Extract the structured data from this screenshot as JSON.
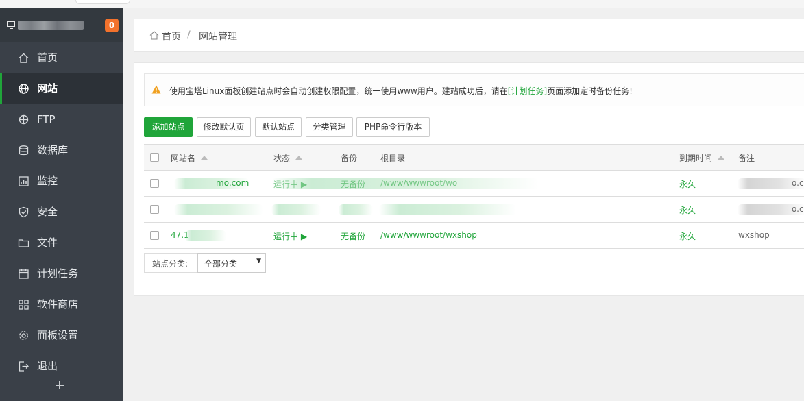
{
  "sidebar": {
    "badge": "0",
    "items": [
      {
        "label": "首页",
        "icon": "home-icon"
      },
      {
        "label": "网站",
        "icon": "globe-icon"
      },
      {
        "label": "FTP",
        "icon": "ftp-icon"
      },
      {
        "label": "数据库",
        "icon": "database-icon"
      },
      {
        "label": "监控",
        "icon": "monitor-icon"
      },
      {
        "label": "安全",
        "icon": "shield-icon"
      },
      {
        "label": "文件",
        "icon": "folder-icon"
      },
      {
        "label": "计划任务",
        "icon": "calendar-icon"
      },
      {
        "label": "软件商店",
        "icon": "apps-grid-icon"
      },
      {
        "label": "面板设置",
        "icon": "gear-icon"
      },
      {
        "label": "退出",
        "icon": "logout-icon"
      }
    ],
    "add_icon": "plus-icon"
  },
  "breadcrumb": {
    "home": "首页",
    "separator": "/",
    "current": "网站管理"
  },
  "alert": {
    "text_before": "使用宝塔Linux面板创建站点时会自动创建权限配置，统一使用www用户。建站成功后，请在",
    "link": "[计划任务]",
    "text_after": "页面添加定时备份任务!"
  },
  "toolbar": {
    "add_site": "添加站点",
    "edit_default_page": "修改默认页",
    "default_site": "默认站点",
    "category_manage": "分类管理",
    "php_cli_version": "PHP命令行版本"
  },
  "table": {
    "headers": {
      "name": "网站名",
      "status": "状态",
      "backup": "备份",
      "root": "根目录",
      "expire": "到期时间",
      "remark": "备注"
    },
    "rows": [
      {
        "name": "mo.com",
        "status": "运行中 ▶",
        "backup": "无备份",
        "root": "/www/wwwroot/wo",
        "expire": "永久",
        "remark": "o.c"
      },
      {
        "name": "",
        "status": "",
        "backup": "",
        "root": "",
        "expire": "永久",
        "remark": "o.c"
      },
      {
        "name": "47.1",
        "status": "运行中 ▶",
        "backup": "无备份",
        "root": "/www/wwwroot/wxshop",
        "expire": "永久",
        "remark": "wxshop"
      }
    ]
  },
  "filter": {
    "label": "站点分类:",
    "selected": "全部分类"
  },
  "colors": {
    "sidebar_bg": "#3a4048",
    "accent_green": "#20a53a",
    "badge_orange": "#f3722c"
  }
}
